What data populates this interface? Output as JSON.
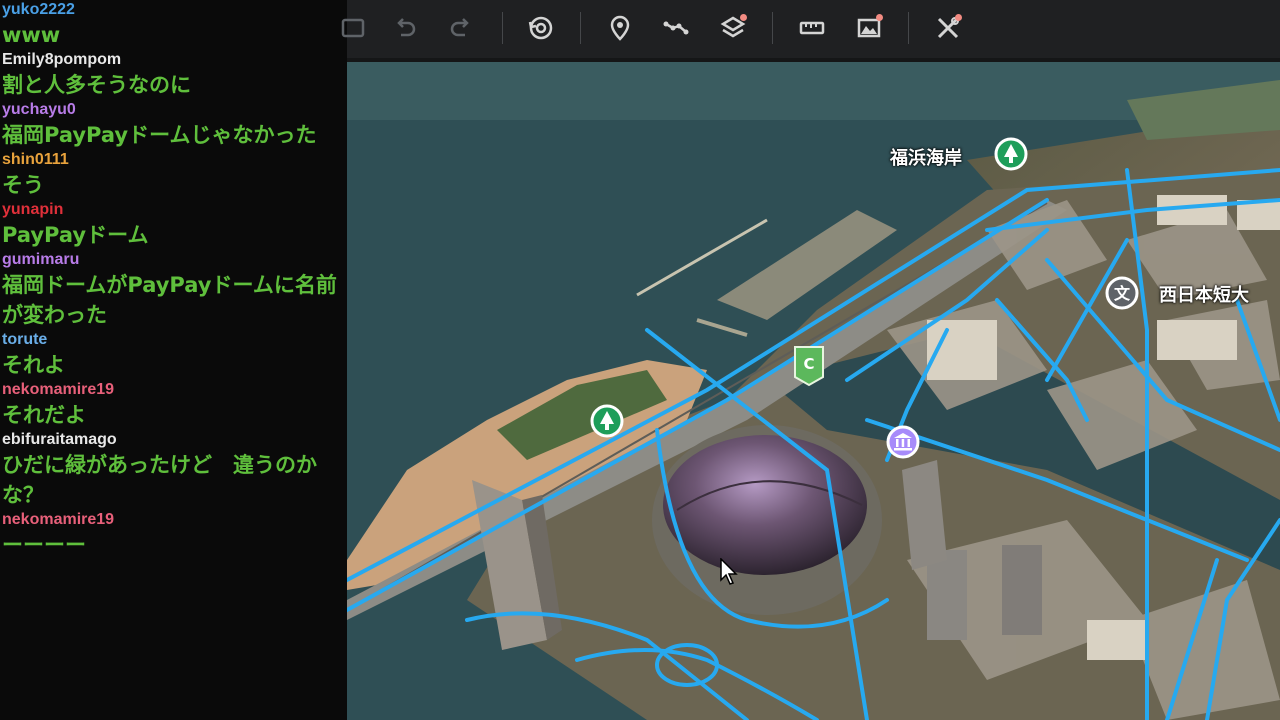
{
  "chat": {
    "messages": [
      {
        "user": "yuko2222",
        "color": "#4aa0e6",
        "text": "www"
      },
      {
        "user": "Emily8pompom",
        "color": "#e8e8e8",
        "text": "割と人多そうなのに"
      },
      {
        "user": "yuchayu0",
        "color": "#b87ce8",
        "text": "福岡PayPayドームじゃなかった"
      },
      {
        "user": "shin0111",
        "color": "#e8a23c",
        "text": "そう"
      },
      {
        "user": "yunapin",
        "color": "#e0303a",
        "text": "PayPayドーム"
      },
      {
        "user": "gumimaru",
        "color": "#b87ce8",
        "text": "福岡ドームがPayPayドームに名前\nが変わった"
      },
      {
        "user": "torute",
        "color": "#6aaee8",
        "text": "それよ"
      },
      {
        "user": "nekomamire19",
        "color": "#e8607a",
        "text": "それだよ"
      },
      {
        "user": "ebifuraitamago",
        "color": "#e8e8e8",
        "text": "ひだに緑があったけど　違うのか\nな？"
      },
      {
        "user": "nekomamire19",
        "color": "#e8607a",
        "text": "ーーーー"
      }
    ]
  },
  "toolbar": {
    "buttons": [
      {
        "name": "partial-icon",
        "icon": "partial"
      },
      {
        "name": "undo-icon",
        "icon": "undo"
      },
      {
        "name": "redo-icon",
        "icon": "redo"
      },
      {
        "name": "history-icon",
        "icon": "history"
      },
      {
        "name": "placemark-icon",
        "icon": "pin"
      },
      {
        "name": "path-icon",
        "icon": "path"
      },
      {
        "name": "layers-icon",
        "icon": "layers",
        "badge": true
      },
      {
        "name": "measure-icon",
        "icon": "ruler"
      },
      {
        "name": "add-image-overlay-icon",
        "icon": "image",
        "badge": true
      },
      {
        "name": "tools-icon",
        "icon": "tools",
        "badge": true
      }
    ],
    "badge_color": "#f28b82"
  },
  "map": {
    "labels": {
      "beach": "福浜海岸",
      "college": "西日本短大"
    },
    "marker_c": "C",
    "colors": {
      "water": "#2f4f55",
      "road": "#27a9f0",
      "park_pin": "#1e9e5a",
      "museum_pin": "#a78bfa",
      "c_pin": "#5cb85c"
    }
  }
}
